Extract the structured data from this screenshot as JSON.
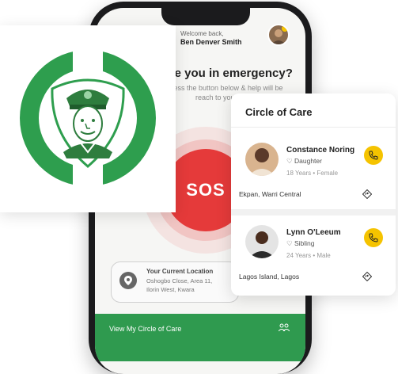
{
  "app": {
    "welcome": "Welcome back,",
    "user_name": "Ben Denver Smith",
    "question": "Are you in emergency?",
    "instruction": "Press the button below & help will be reach to you soon.",
    "sos_label": "SOS",
    "location": {
      "title": "Your Current Location",
      "line1": "Oshogbo Close, Area 11,",
      "line2": "Ilorin West, Kwara"
    },
    "bottom_bar": {
      "label": "View My Circle of Care",
      "icon": "people-icon"
    }
  },
  "care": {
    "title": "Circle of Care",
    "contacts": [
      {
        "name": "Constance Noring",
        "relation": "Daughter",
        "meta": "18 Years • Female",
        "address": "Ekpan, Warri Central"
      },
      {
        "name": "Lynn O'Leeum",
        "relation": "Sibling",
        "meta": "24 Years • Male",
        "address": "Lagos Island, Lagos"
      }
    ]
  },
  "colors": {
    "brand_green": "#2f9a4f",
    "sos_red": "#e53a3a",
    "call_yellow": "#f5c300"
  }
}
